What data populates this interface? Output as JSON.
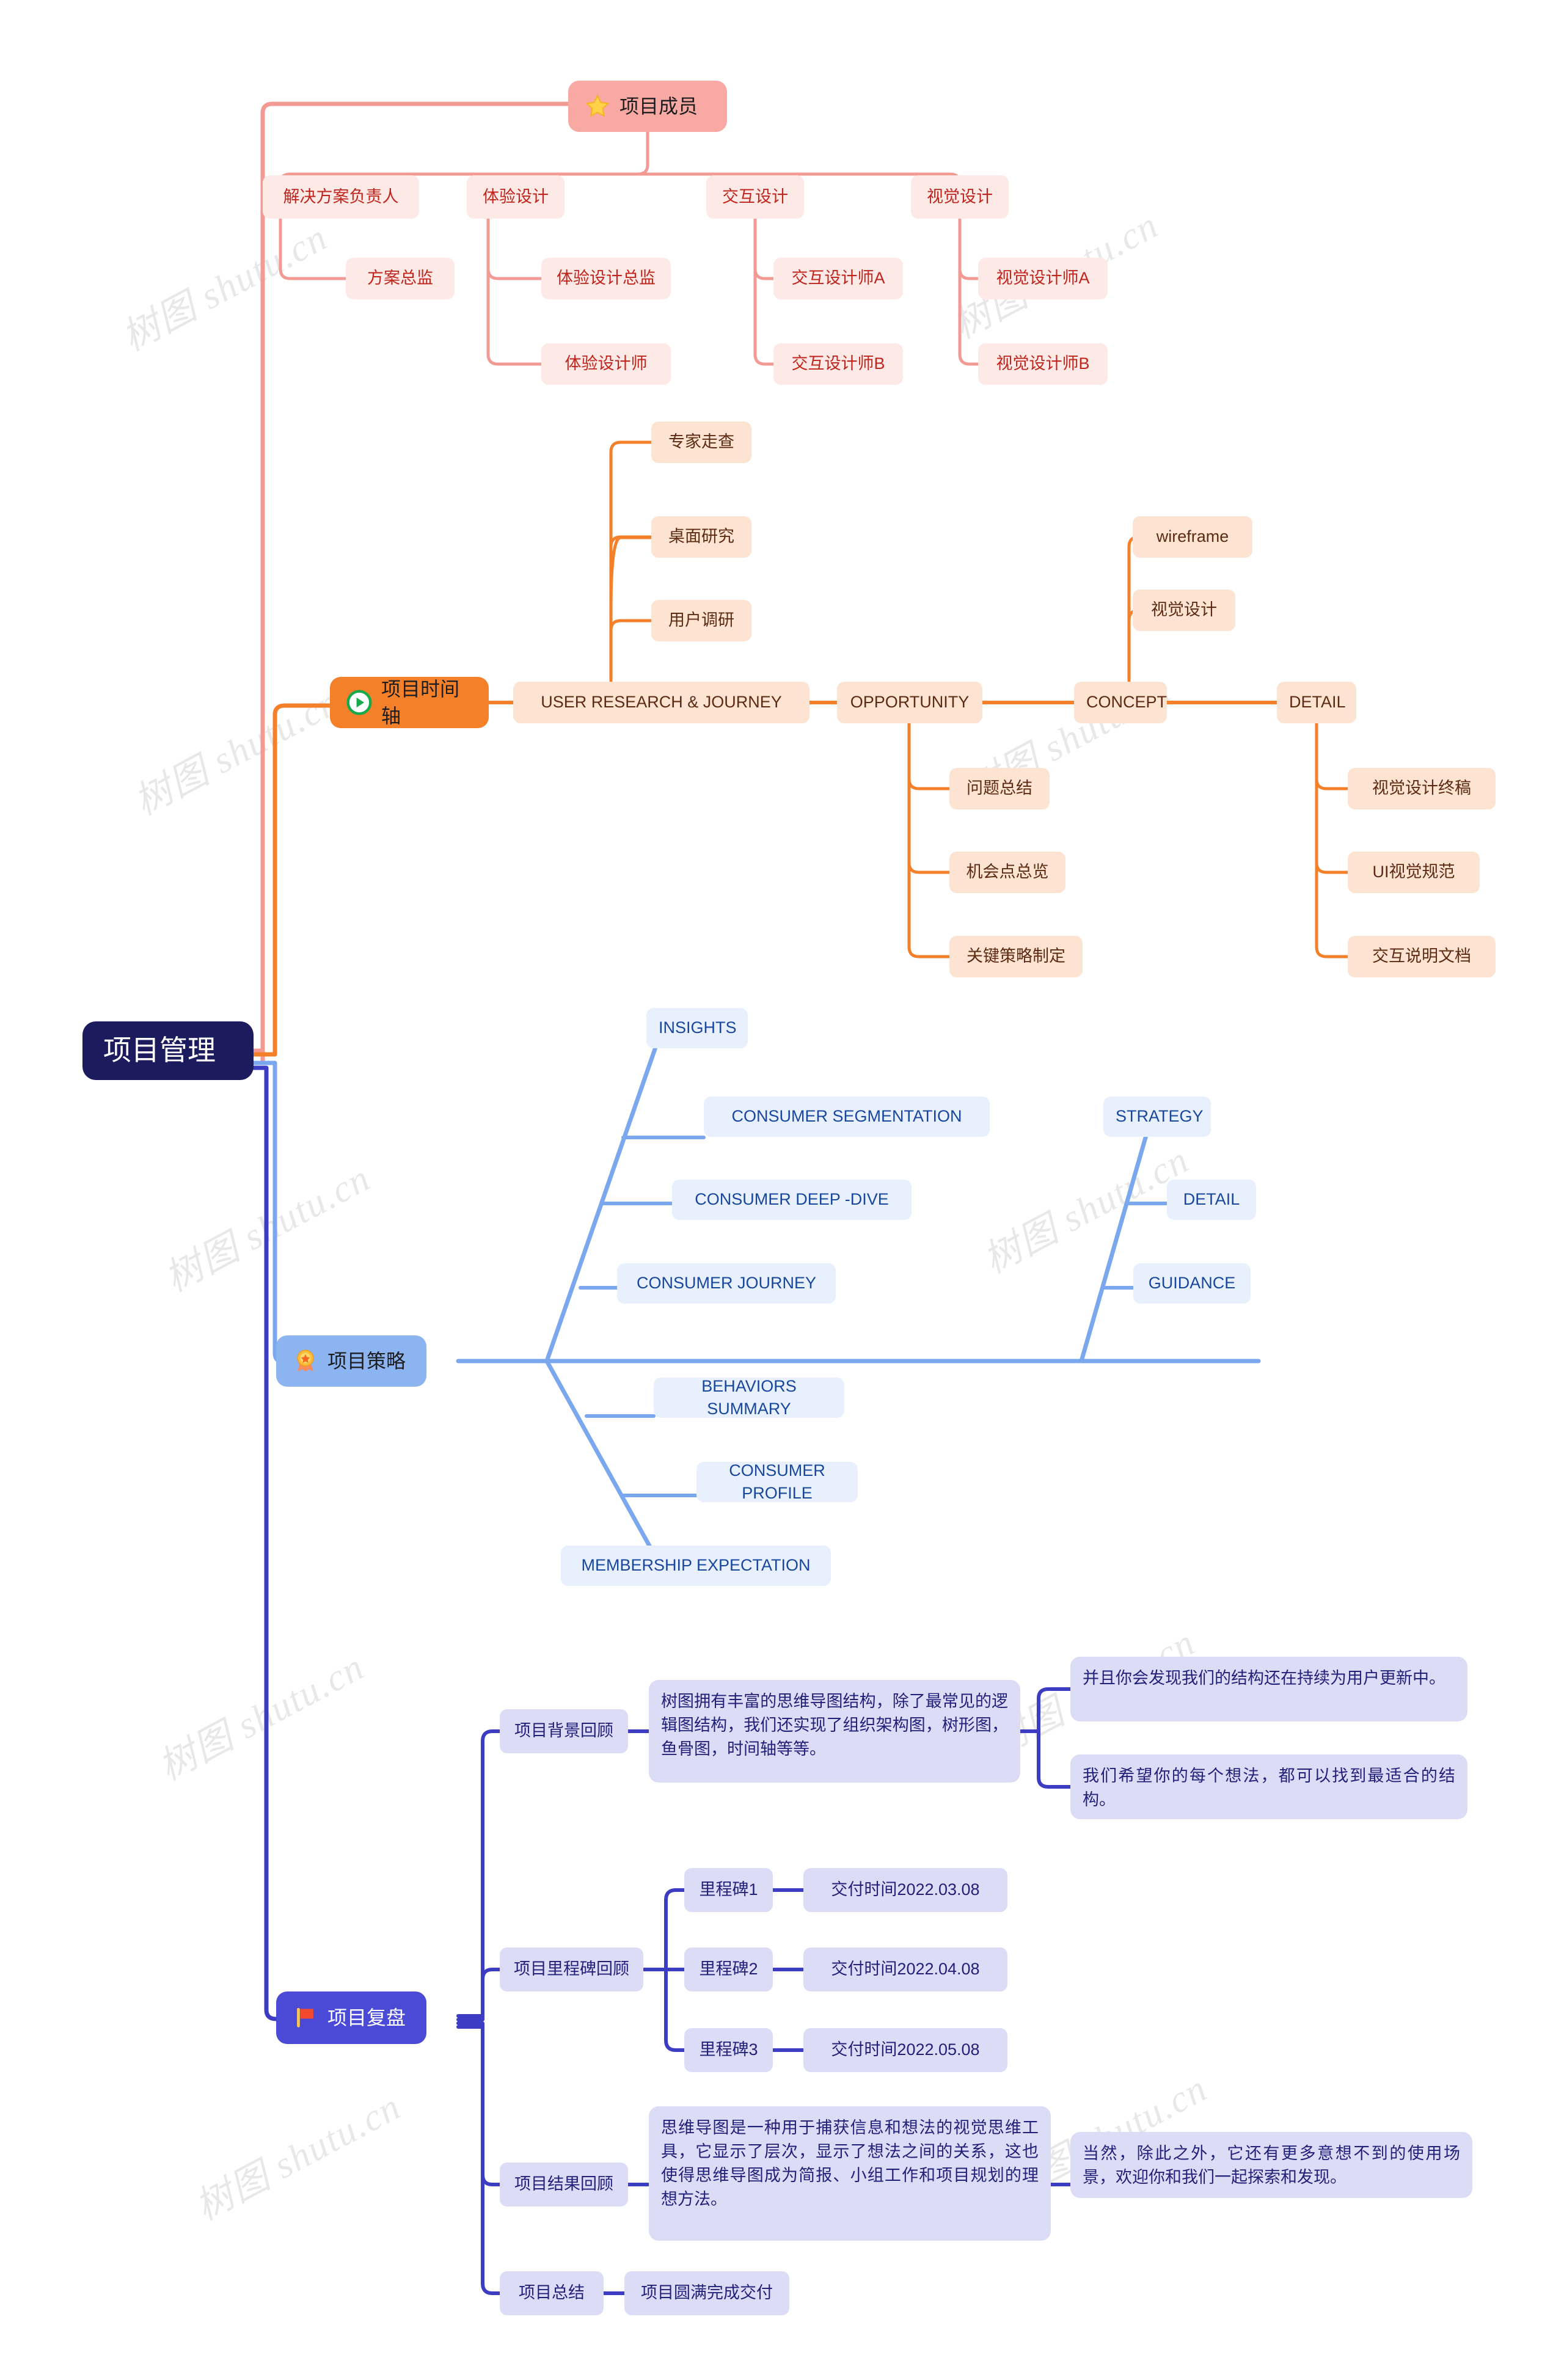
{
  "root": {
    "label": "项目管理"
  },
  "colors": {
    "root_bg": "#1c1b5e",
    "members_accent": "#f49a94",
    "timeline_accent": "#f4812a",
    "strategy_accent": "#7ba7ef",
    "review_accent": "#3d3dc4",
    "members_node_bg": "#fdeae7",
    "timeline_node_bg": "#fce3d2",
    "strategy_node_bg": "#e8f0fd",
    "review_node_bg": "#dcdcf7"
  },
  "watermark": {
    "text": "树图 shutu.cn"
  },
  "branches": {
    "members": {
      "label": "项目成员",
      "icon": "star-icon",
      "children": [
        {
          "label": "解决方案负责人",
          "children": [
            {
              "label": "方案总监"
            }
          ]
        },
        {
          "label": "体验设计",
          "children": [
            {
              "label": "体验设计总监"
            },
            {
              "label": "体验设计师"
            }
          ]
        },
        {
          "label": "交互设计",
          "children": [
            {
              "label": "交互设计师A"
            },
            {
              "label": "交互设计师B"
            }
          ]
        },
        {
          "label": "视觉设计",
          "children": [
            {
              "label": "视觉设计师A"
            },
            {
              "label": "视觉设计师B"
            }
          ]
        }
      ]
    },
    "timeline": {
      "label": "项目时间轴",
      "icon": "play-circle-icon",
      "stages": [
        {
          "label": "USER RESEARCH & JOURNEY",
          "children": [
            {
              "label": "专家走查"
            },
            {
              "label": "桌面研究"
            },
            {
              "label": "用户调研"
            }
          ]
        },
        {
          "label": "OPPORTUNITY",
          "children": [
            {
              "label": "问题总结"
            },
            {
              "label": "机会点总览"
            },
            {
              "label": "关键策略制定"
            }
          ]
        },
        {
          "label": "CONCEPT",
          "children": [
            {
              "label": "wireframe"
            },
            {
              "label": "视觉设计"
            }
          ]
        },
        {
          "label": "DETAIL",
          "children": [
            {
              "label": "视觉设计终稿"
            },
            {
              "label": "UI视觉规范"
            },
            {
              "label": "交互说明文档"
            }
          ]
        }
      ]
    },
    "strategy": {
      "label": "项目策略",
      "icon": "medal-icon",
      "bones": [
        {
          "label": "INSIGHTS",
          "side": "top",
          "children": [
            {
              "label": "CONSUMER SEGMENTATION"
            },
            {
              "label": "CONSUMER DEEP -DIVE"
            },
            {
              "label": "CONSUMER JOURNEY"
            }
          ]
        },
        {
          "label": "STRATEGY",
          "side": "top",
          "children": [
            {
              "label": "DETAIL"
            },
            {
              "label": "GUIDANCE"
            }
          ]
        },
        {
          "label": "MEMBERSHIP EXPECTATION",
          "side": "bottom",
          "children": [
            {
              "label": "BEHAVIORS SUMMARY"
            },
            {
              "label": "CONSUMER PROFILE"
            }
          ]
        }
      ]
    },
    "review": {
      "label": "项目复盘",
      "icon": "flag-icon",
      "children": [
        {
          "label": "项目背景回顾",
          "children": [
            {
              "label": "树图拥有丰富的思维导图结构，除了最常见的逻辑图结构，我们还实现了组织架构图，树形图，鱼骨图，时间轴等等。",
              "children": [
                {
                  "label": "并且你会发现我们的结构还在持续为用户更新中。"
                },
                {
                  "label": "我们希望你的每个想法，都可以找到最适合的结构。"
                }
              ]
            }
          ]
        },
        {
          "label": "项目里程碑回顾",
          "children": [
            {
              "label": "里程碑1",
              "children": [
                {
                  "label": "交付时间2022.03.08"
                }
              ]
            },
            {
              "label": "里程碑2",
              "children": [
                {
                  "label": "交付时间2022.04.08"
                }
              ]
            },
            {
              "label": "里程碑3",
              "children": [
                {
                  "label": "交付时间2022.05.08"
                }
              ]
            }
          ]
        },
        {
          "label": "项目结果回顾",
          "children": [
            {
              "label": "思维导图是一种用于捕获信息和想法的视觉思维工具，它显示了层次，显示了想法之间的关系，这也使得思维导图成为简报、小组工作和项目规划的理想方法。",
              "children": [
                {
                  "label": "当然，除此之外，它还有更多意想不到的使用场景，欢迎你和我们一起探索和发现。"
                }
              ]
            }
          ]
        },
        {
          "label": "项目总结",
          "children": [
            {
              "label": "项目圆满完成交付"
            }
          ]
        }
      ]
    }
  }
}
